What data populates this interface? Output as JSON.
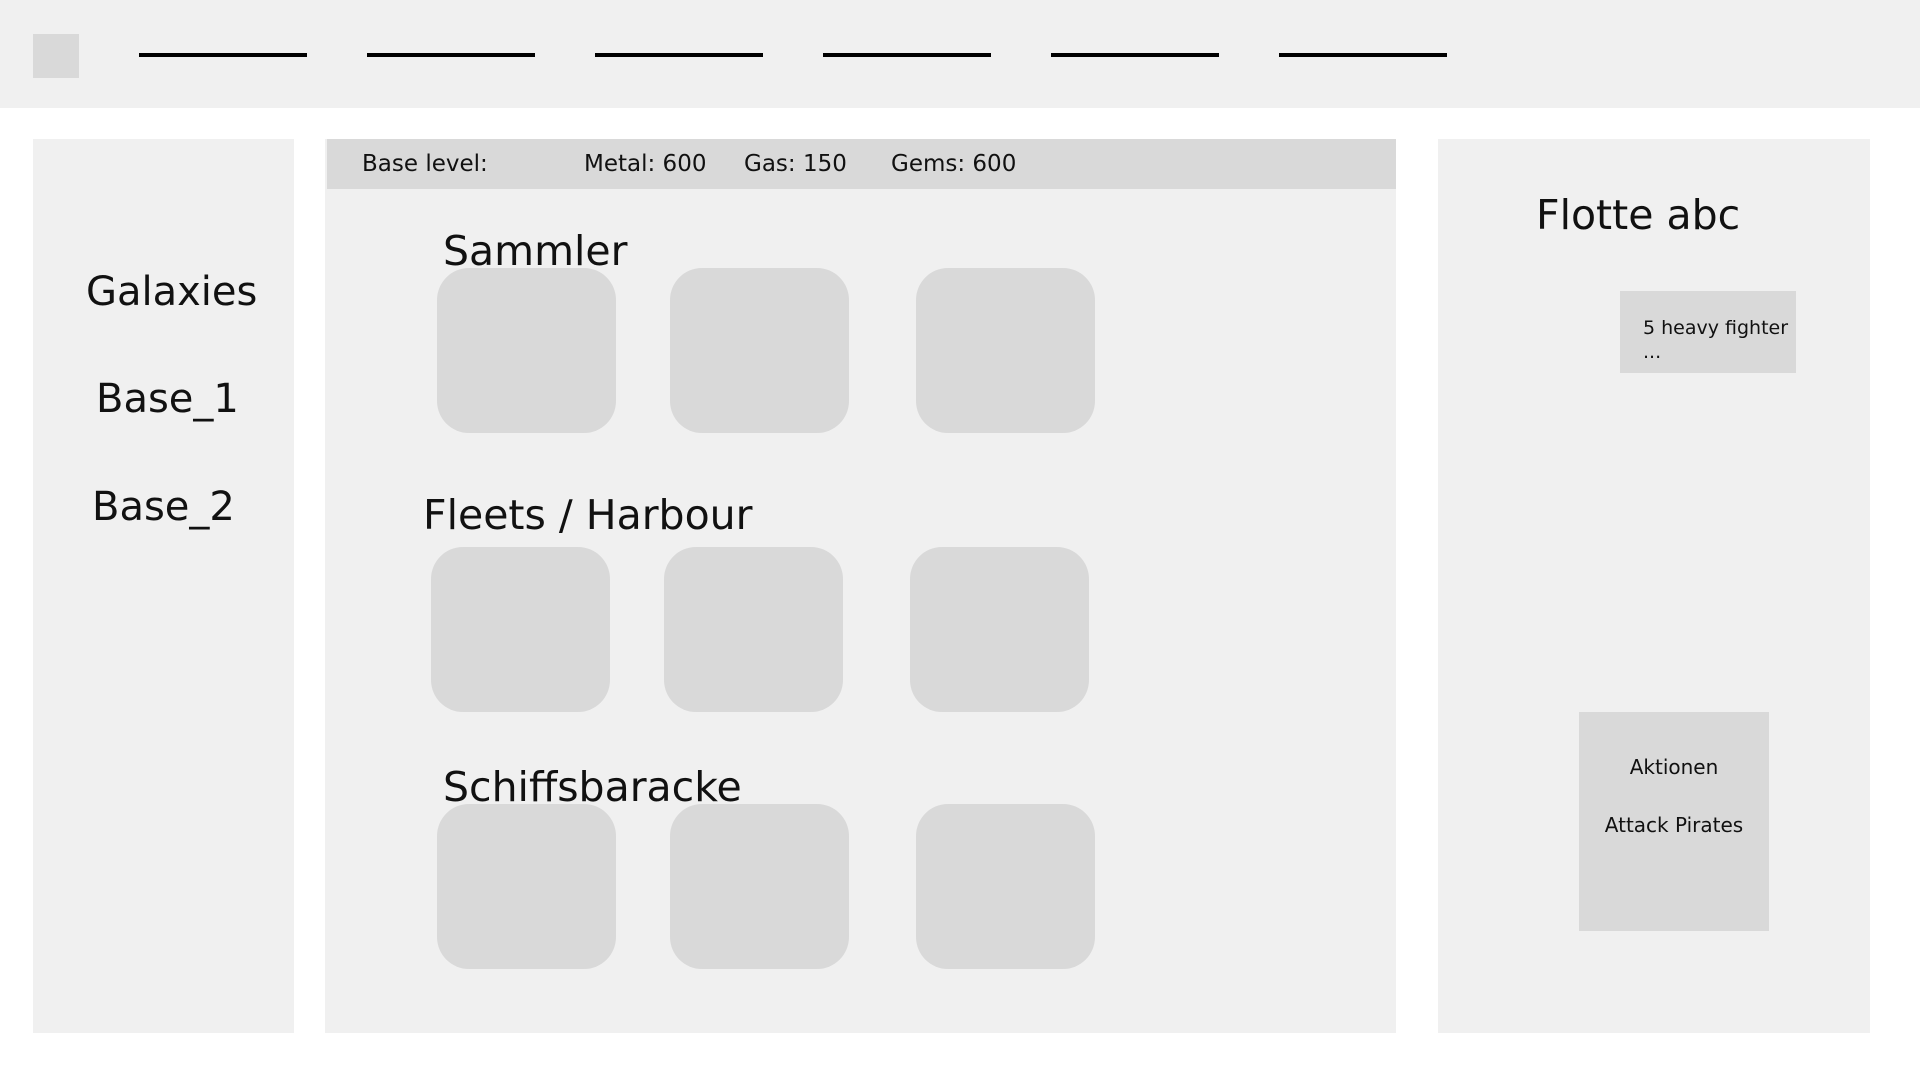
{
  "sidebar": {
    "items": [
      {
        "label": "Galaxies"
      },
      {
        "label": "Base_1"
      },
      {
        "label": "Base_2"
      }
    ]
  },
  "resources": {
    "base_level": "Base level:",
    "metal": "Metal: 600",
    "gas": "Gas: 150",
    "gems": "Gems: 600"
  },
  "sections": [
    {
      "title": "Sammler"
    },
    {
      "title": "Fleets / Harbour"
    },
    {
      "title": "Schiffsbaracke"
    }
  ],
  "fleet": {
    "title": "Flotte abc",
    "units_line1": "5 heavy fighter",
    "units_line2": "...",
    "actions_title": "Aktionen",
    "actions": [
      {
        "label": "Attack Pirates"
      }
    ]
  }
}
